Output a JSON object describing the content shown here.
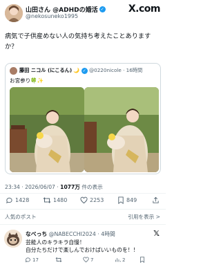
{
  "author": {
    "name": "山田さん @ADHDの婚活",
    "handle": "@nekosuneko1995"
  },
  "brand": {
    "logo_text": "X.com"
  },
  "tweet": {
    "text": "病気で子供産めない人の気持ち考えたことありますか？",
    "time": "23:34 · 2026/06/07 ·",
    "views_count": "1077万",
    "views_label": "件の表示"
  },
  "quoted": {
    "name": "藤田 ニコル (にこるん)",
    "handle": "@0220nicole",
    "time": "· 16時間",
    "text": "お宮参り🍀✨"
  },
  "actions": {
    "replies": "1428",
    "retweets": "1480",
    "likes": "2253",
    "bookmarks": "849"
  },
  "tabs": {
    "popular": "人気のポスト",
    "quotes": "引用を表示 >"
  },
  "reply": {
    "name": "なべっち",
    "handle": "@NABECCHI2024",
    "time": "· 4時間",
    "text_line1": "芸能人のキラキラ自慢！",
    "text_line2": "自分たちだけで楽しんでおけばいいものを！！",
    "replies": "17",
    "retweets": "",
    "likes": "7",
    "views": "2"
  },
  "colors": {
    "accent": "#1d9bf0",
    "text": "#0f1419",
    "muted": "#536471",
    "border": "#cfd9de"
  }
}
